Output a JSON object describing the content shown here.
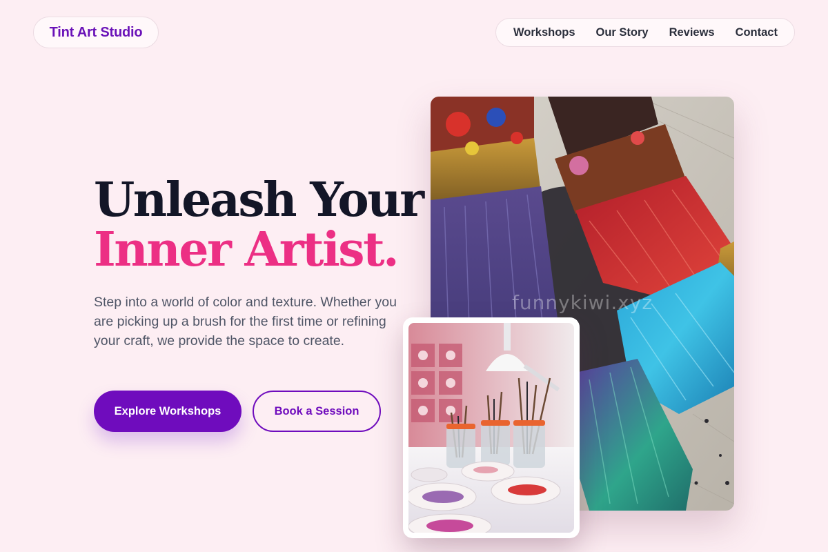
{
  "header": {
    "brand": "Tint Art Studio",
    "nav": [
      "Workshops",
      "Our Story",
      "Reviews",
      "Contact"
    ]
  },
  "hero": {
    "headline_line1": "Unleash Your",
    "headline_line2": "Inner Artist.",
    "lede": "Step into a world of color and texture. Whether you are picking up a brush for the first time or refining your craft, we provide the space to create.",
    "cta_primary": "Explore Workshops",
    "cta_secondary": "Book a Session",
    "watermark": "funnykiwi.xyz"
  },
  "colors": {
    "background": "#fdeef3",
    "brand_purple": "#6f0cbd",
    "accent_pink": "#ec2f84",
    "heading": "#131627",
    "body_text": "#4f5566"
  },
  "images": {
    "hero": "paint-brushes-photo",
    "inset": "studio-brush-jars-photo"
  }
}
